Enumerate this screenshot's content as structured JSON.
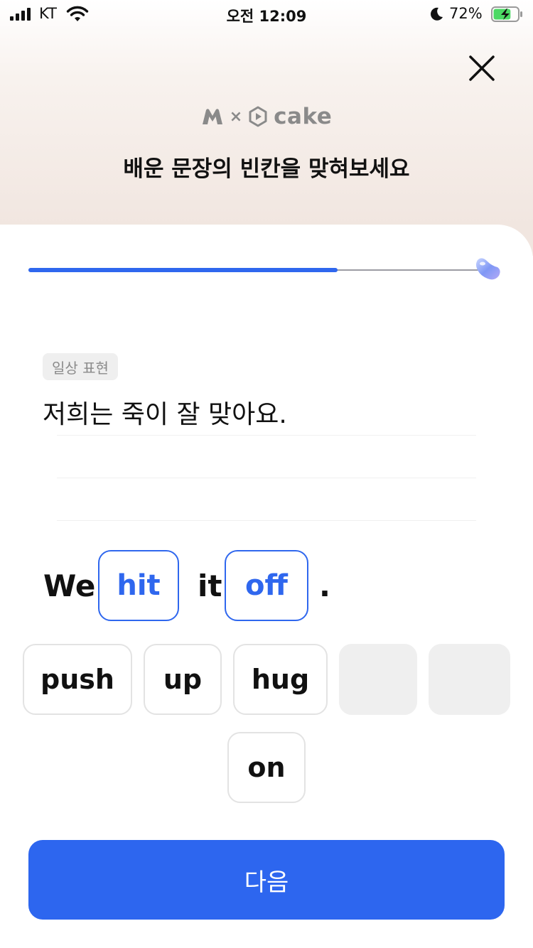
{
  "status_bar": {
    "carrier": "KT",
    "time": "오전 12:09",
    "battery_percent": "72%",
    "battery_level": 0.72
  },
  "header": {
    "brand_cake": "cake",
    "brand_x": "×",
    "title": "배운 문장의 빈칸을 맞혀보세요"
  },
  "progress": {
    "fraction": 0.68
  },
  "question": {
    "tag": "일상 표현",
    "korean_sentence": "저희는 죽이 잘 맞아요.",
    "english": {
      "w1": "We",
      "blank1": "hit",
      "w2": "it",
      "blank2": "off",
      "end": "."
    }
  },
  "choices": [
    "push",
    "up",
    "hug",
    "on"
  ],
  "buttons": {
    "next_label": "다음"
  },
  "colors": {
    "accent": "#2f67ee",
    "button": "#2d66ef",
    "chip_border": "#e3e3e3"
  },
  "icons": [
    "signal-icon",
    "wifi-icon",
    "moon-icon",
    "battery-icon",
    "close-icon",
    "brand-m-icon",
    "cake-logo-icon",
    "jelly-bean-icon"
  ]
}
